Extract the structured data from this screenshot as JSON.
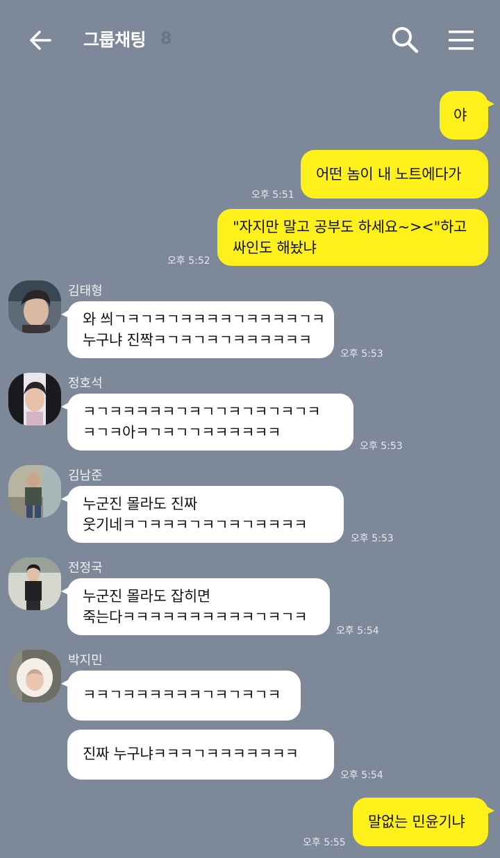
{
  "header": {
    "title": "그룹채팅",
    "member_count": "8",
    "icons": {
      "back": "back-arrow-icon",
      "search": "search-icon",
      "menu": "hamburger-menu-icon"
    }
  },
  "colors": {
    "background": "#7d8898",
    "my_bubble": "#fef01b",
    "other_bubble": "#ffffff"
  },
  "messages": [
    {
      "from": "me",
      "text": "야",
      "time": ""
    },
    {
      "from": "me",
      "text": "어떤 놈이 내 노트에다가",
      "time": "오후 5:51"
    },
    {
      "from": "me",
      "text": "\"자지만 말고 공부도 하세요~><\"하고\n싸인도 해놨냐",
      "time": "오후 5:52"
    },
    {
      "from": "김태형",
      "text": "와 씌ㄱㅋㄱㅋㄱㅋㅋㅋㅋㄱㅋㅋㅋㅋㄱㅋ\n누구냐 진짝ㅋㄱㅋㄱㅋㄱㅋㅋㅋㅋㅋㅋ",
      "time": "오후 5:53"
    },
    {
      "from": "정호석",
      "text": "ㅋㄱㅋㅋㅋㅋㅋㄱㅋㄱㄱㅋㄱㅋㄱㅋㄱㅋ\nㅋㄱㅋ아ㅋㄱㅋㄱㄱㅋㅋㅋㅋㅋㅋ",
      "time": "오후 5:53"
    },
    {
      "from": "김남준",
      "text": "누군진 몰라도 진짜\n웃기네ㅋㄱㅋㅋㅋㄱㅋㄱㅋㄱㅋㅋㅋㅋ",
      "time": "오후 5:53"
    },
    {
      "from": "전정국",
      "text": "누군진 몰라도 잡히면\n죽는다ㅋㅋㅋㅋㅋㅋㅋㅋㅋㅋㄱㅋㄱㅋ",
      "time": "오후 5:54"
    },
    {
      "from": "박지민",
      "text": "ㅋㅋㄱㅋㅋㅋㅋㅋㅋㄱㅋㄱㅋㄱㅋ",
      "time": ""
    },
    {
      "from": "박지민",
      "text": "진짜 누구냐ㅋㅋㅋㄱㅋㅋㅋㅋㅋㅋㅋ",
      "time": "오후 5:54"
    },
    {
      "from": "me",
      "text": "말없는 민윤기냐",
      "time": "오후 5:55"
    }
  ]
}
